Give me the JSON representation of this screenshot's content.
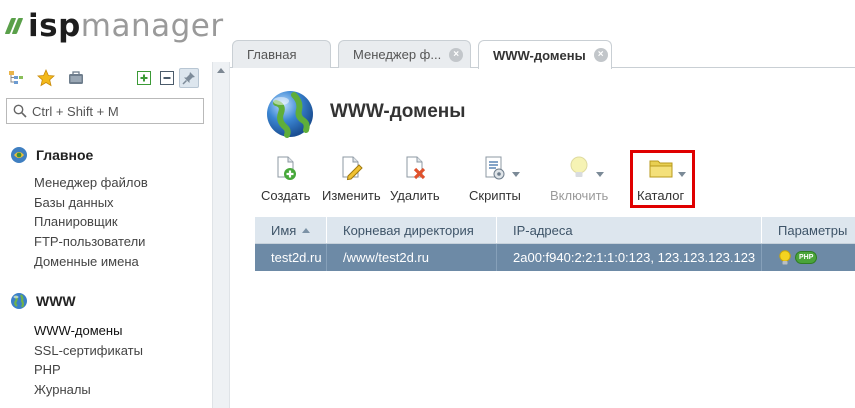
{
  "app": {
    "logo_part1": "isp",
    "logo_part2": "manager"
  },
  "sidebar": {
    "search_placeholder": "Ctrl + Shift + M",
    "groups": [
      {
        "title": "Главное",
        "items": [
          "Менеджер файлов",
          "Базы данных",
          "Планировщик",
          "FTP-пользователи",
          "Доменные имена"
        ]
      },
      {
        "title": "WWW",
        "items": [
          "WWW-домены",
          "SSL-сертификаты",
          "PHP",
          "Журналы"
        ]
      }
    ]
  },
  "tabs": [
    {
      "label": "Главная"
    },
    {
      "label": "Менеджер ф..."
    },
    {
      "label": "WWW-домены"
    }
  ],
  "page": {
    "title": "WWW-домены"
  },
  "toolbar": {
    "create": "Создать",
    "edit": "Изменить",
    "delete": "Удалить",
    "scripts": "Скрипты",
    "enable": "Включить",
    "catalog": "Каталог"
  },
  "table": {
    "columns": [
      "Имя",
      "Корневая директория",
      "IP-адреса",
      "Параметры"
    ],
    "rows": [
      {
        "name": "test2d.ru",
        "root": "/www/test2d.ru",
        "ips": "2a00:f940:2:2:1:1:0:123, 123.123.123.123",
        "php_badge": "PHP"
      }
    ]
  },
  "colors": {
    "accent_green": "#5aa04a",
    "header_bg": "#dde6ee",
    "selected_row": "#6d8aa6",
    "highlight": "#e00000"
  }
}
